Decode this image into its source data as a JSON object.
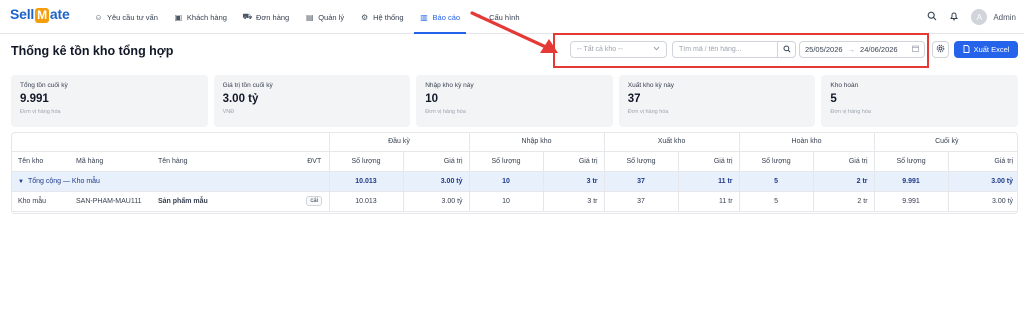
{
  "brand": {
    "logo_left": "Sell",
    "logo_mid": "M",
    "logo_right": "ate"
  },
  "nav": [
    {
      "label": "Yêu cầu tư vấn",
      "icon": "chat-icon",
      "glyph": "☺"
    },
    {
      "label": "Khách hàng",
      "icon": "user-card-icon",
      "glyph": "▣"
    },
    {
      "label": "Đơn hàng",
      "icon": "cart-icon",
      "glyph": "⛟"
    },
    {
      "label": "Quản lý",
      "icon": "folder-icon",
      "glyph": "▤"
    },
    {
      "label": "Hệ thống",
      "icon": "gear-icon",
      "glyph": "⚙"
    },
    {
      "label": "Báo cáo",
      "icon": "chart-icon",
      "glyph": "▥",
      "active": true
    },
    {
      "label": "Cấu hình",
      "icon": "wrench-icon",
      "glyph": "✎"
    }
  ],
  "user": {
    "avatar_initial": "A",
    "name": "Admin"
  },
  "page": {
    "title": "Thống kê tồn kho tổng hợp"
  },
  "filters": {
    "warehouse_select": "-- Tất cả kho --",
    "search_placeholder": "Tìm mã / tên hàng...",
    "date_from": "25/05/2026",
    "date_to": "24/06/2026",
    "export_label": "Xuất Excel"
  },
  "cards": [
    {
      "label": "Tổng tồn cuối kỳ",
      "value": "9.991",
      "sub": "Đơn vị hàng hóa"
    },
    {
      "label": "Giá trị tồn cuối kỳ",
      "value": "3.00 tỷ",
      "sub": "VNĐ"
    },
    {
      "label": "Nhập kho kỳ này",
      "value": "10",
      "sub": "Đơn vị hàng hóa"
    },
    {
      "label": "Xuất kho kỳ này",
      "value": "37",
      "sub": "Đơn vị hàng hóa"
    },
    {
      "label": "Kho hoàn",
      "value": "5",
      "sub": "Đơn vị hàng hóa"
    }
  ],
  "table": {
    "group_headers": [
      "Đầu kỳ",
      "Nhập kho",
      "Xuất kho",
      "Hoàn kho",
      "Cuối kỳ"
    ],
    "columns": [
      "Tên kho",
      "Mã hàng",
      "Tên hàng",
      "ĐVT"
    ],
    "sub_qty": "Số lượng",
    "sub_val": "Giá trị",
    "total_row": {
      "label": "Tổng cộng — Kho mẫu",
      "values": [
        "10.013",
        "3.00 tỷ",
        "10",
        "3 tr",
        "37",
        "11 tr",
        "5",
        "2 tr",
        "9.991",
        "3.00 tỷ"
      ]
    },
    "rows": [
      {
        "warehouse": "Kho mẫu",
        "sku": "SAN-PHAM-MAU111",
        "name": "Sản phẩm mẫu",
        "unit": "cái",
        "values": [
          "10.013",
          "3.00 tỷ",
          "10",
          "3 tr",
          "37",
          "11 tr",
          "5",
          "2 tr",
          "9.991",
          "3.00 tỷ"
        ]
      }
    ]
  },
  "colors": {
    "primary": "#2563eb",
    "highlight_box": "#e53935",
    "total_row_bg": "#e8f1fb"
  }
}
